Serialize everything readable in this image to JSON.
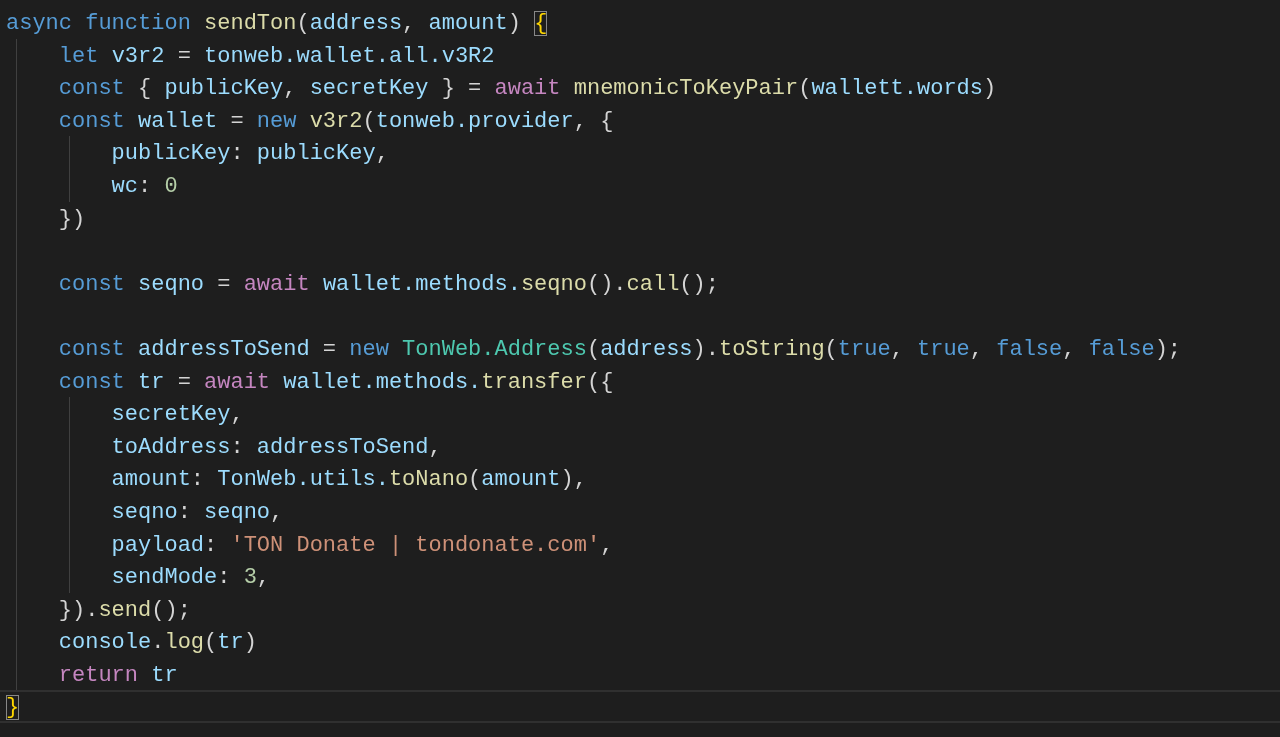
{
  "editor": {
    "lines": [
      {
        "current": false,
        "tokens": [
          {
            "t": "async function ",
            "kind": "keyword"
          },
          {
            "t": "sendTon",
            "kind": "func"
          },
          {
            "t": "(",
            "kind": "plain"
          },
          {
            "t": "address",
            "kind": "var"
          },
          {
            "t": ", ",
            "kind": "plain"
          },
          {
            "t": "amount",
            "kind": "var"
          },
          {
            "t": ") ",
            "kind": "plain"
          },
          {
            "t": "{",
            "kind": "bracket"
          }
        ]
      },
      {
        "current": false,
        "tokens": [
          {
            "t": "    let ",
            "kind": "keyword"
          },
          {
            "t": "v3r2",
            "kind": "var"
          },
          {
            "t": " = ",
            "kind": "plain"
          },
          {
            "t": "tonweb.wallet.all.v3R2",
            "kind": "var"
          }
        ]
      },
      {
        "current": false,
        "tokens": [
          {
            "t": "    const ",
            "kind": "keyword"
          },
          {
            "t": "{ ",
            "kind": "plain"
          },
          {
            "t": "publicKey",
            "kind": "var"
          },
          {
            "t": ", ",
            "kind": "plain"
          },
          {
            "t": "secretKey",
            "kind": "var"
          },
          {
            "t": " } = ",
            "kind": "plain"
          },
          {
            "t": "await ",
            "kind": "control"
          },
          {
            "t": "mnemonicToKeyPair",
            "kind": "func"
          },
          {
            "t": "(",
            "kind": "plain"
          },
          {
            "t": "wallett.words",
            "kind": "var"
          },
          {
            "t": ")",
            "kind": "plain"
          }
        ]
      },
      {
        "current": false,
        "tokens": [
          {
            "t": "    const ",
            "kind": "keyword"
          },
          {
            "t": "wallet",
            "kind": "var"
          },
          {
            "t": " = ",
            "kind": "plain"
          },
          {
            "t": "new ",
            "kind": "keyword"
          },
          {
            "t": "v3r2",
            "kind": "func"
          },
          {
            "t": "(",
            "kind": "plain"
          },
          {
            "t": "tonweb.provider",
            "kind": "var"
          },
          {
            "t": ", {",
            "kind": "plain"
          }
        ]
      },
      {
        "current": false,
        "tokens": [
          {
            "t": "        publicKey",
            "kind": "var"
          },
          {
            "t": ": ",
            "kind": "plain"
          },
          {
            "t": "publicKey",
            "kind": "var"
          },
          {
            "t": ",",
            "kind": "plain"
          }
        ]
      },
      {
        "current": false,
        "tokens": [
          {
            "t": "        wc",
            "kind": "var"
          },
          {
            "t": ": ",
            "kind": "plain"
          },
          {
            "t": "0",
            "kind": "number"
          }
        ]
      },
      {
        "current": false,
        "tokens": [
          {
            "t": "    })",
            "kind": "plain"
          }
        ]
      },
      {
        "current": false
      },
      {
        "current": false,
        "tokens": [
          {
            "t": "    const ",
            "kind": "keyword"
          },
          {
            "t": "seqno",
            "kind": "var"
          },
          {
            "t": " = ",
            "kind": "plain"
          },
          {
            "t": "await ",
            "kind": "control"
          },
          {
            "t": "wallet.methods.",
            "kind": "var"
          },
          {
            "t": "seqno",
            "kind": "func"
          },
          {
            "t": "().",
            "kind": "plain"
          },
          {
            "t": "call",
            "kind": "func"
          },
          {
            "t": "();",
            "kind": "plain"
          }
        ]
      },
      {
        "current": false
      },
      {
        "current": false,
        "tokens": [
          {
            "t": "    const ",
            "kind": "keyword"
          },
          {
            "t": "addressToSend",
            "kind": "var"
          },
          {
            "t": " = ",
            "kind": "plain"
          },
          {
            "t": "new ",
            "kind": "keyword"
          },
          {
            "t": "TonWeb.Address",
            "kind": "type"
          },
          {
            "t": "(",
            "kind": "plain"
          },
          {
            "t": "address",
            "kind": "var"
          },
          {
            "t": ").",
            "kind": "plain"
          },
          {
            "t": "toString",
            "kind": "func"
          },
          {
            "t": "(",
            "kind": "plain"
          },
          {
            "t": "true",
            "kind": "keyword"
          },
          {
            "t": ", ",
            "kind": "plain"
          },
          {
            "t": "true",
            "kind": "keyword"
          },
          {
            "t": ", ",
            "kind": "plain"
          },
          {
            "t": "false",
            "kind": "keyword"
          },
          {
            "t": ", ",
            "kind": "plain"
          },
          {
            "t": "false",
            "kind": "keyword"
          },
          {
            "t": ");",
            "kind": "plain"
          }
        ]
      },
      {
        "current": false,
        "tokens": [
          {
            "t": "    const ",
            "kind": "keyword"
          },
          {
            "t": "tr",
            "kind": "var"
          },
          {
            "t": " = ",
            "kind": "plain"
          },
          {
            "t": "await ",
            "kind": "control"
          },
          {
            "t": "wallet.methods.",
            "kind": "var"
          },
          {
            "t": "transfer",
            "kind": "func"
          },
          {
            "t": "({",
            "kind": "plain"
          }
        ]
      },
      {
        "current": false,
        "tokens": [
          {
            "t": "        secretKey",
            "kind": "var"
          },
          {
            "t": ",",
            "kind": "plain"
          }
        ]
      },
      {
        "current": false,
        "tokens": [
          {
            "t": "        toAddress",
            "kind": "var"
          },
          {
            "t": ": ",
            "kind": "plain"
          },
          {
            "t": "addressToSend",
            "kind": "var"
          },
          {
            "t": ",",
            "kind": "plain"
          }
        ]
      },
      {
        "current": false,
        "tokens": [
          {
            "t": "        amount",
            "kind": "var"
          },
          {
            "t": ": ",
            "kind": "plain"
          },
          {
            "t": "TonWeb.utils.",
            "kind": "var"
          },
          {
            "t": "toNano",
            "kind": "func"
          },
          {
            "t": "(",
            "kind": "plain"
          },
          {
            "t": "amount",
            "kind": "var"
          },
          {
            "t": "),",
            "kind": "plain"
          }
        ]
      },
      {
        "current": false,
        "tokens": [
          {
            "t": "        seqno",
            "kind": "var"
          },
          {
            "t": ": ",
            "kind": "plain"
          },
          {
            "t": "seqno",
            "kind": "var"
          },
          {
            "t": ",",
            "kind": "plain"
          }
        ]
      },
      {
        "current": false,
        "tokens": [
          {
            "t": "        payload",
            "kind": "var"
          },
          {
            "t": ": ",
            "kind": "plain"
          },
          {
            "t": "'TON Donate | tondonate.com'",
            "kind": "string"
          },
          {
            "t": ",",
            "kind": "plain"
          }
        ]
      },
      {
        "current": false,
        "tokens": [
          {
            "t": "        sendMode",
            "kind": "var"
          },
          {
            "t": ": ",
            "kind": "plain"
          },
          {
            "t": "3",
            "kind": "number"
          },
          {
            "t": ",",
            "kind": "plain"
          }
        ]
      },
      {
        "current": false,
        "tokens": [
          {
            "t": "    }).",
            "kind": "plain"
          },
          {
            "t": "send",
            "kind": "func"
          },
          {
            "t": "();",
            "kind": "plain"
          }
        ]
      },
      {
        "current": false,
        "tokens": [
          {
            "t": "    console",
            "kind": "var"
          },
          {
            "t": ".",
            "kind": "plain"
          },
          {
            "t": "log",
            "kind": "func"
          },
          {
            "t": "(",
            "kind": "plain"
          },
          {
            "t": "tr",
            "kind": "var"
          },
          {
            "t": ")",
            "kind": "plain"
          }
        ]
      },
      {
        "current": false,
        "tokens": [
          {
            "t": "    return ",
            "kind": "control"
          },
          {
            "t": "tr",
            "kind": "var"
          }
        ]
      },
      {
        "current": true,
        "tokens": [
          {
            "t": "}",
            "kind": "bracket"
          }
        ]
      }
    ]
  }
}
